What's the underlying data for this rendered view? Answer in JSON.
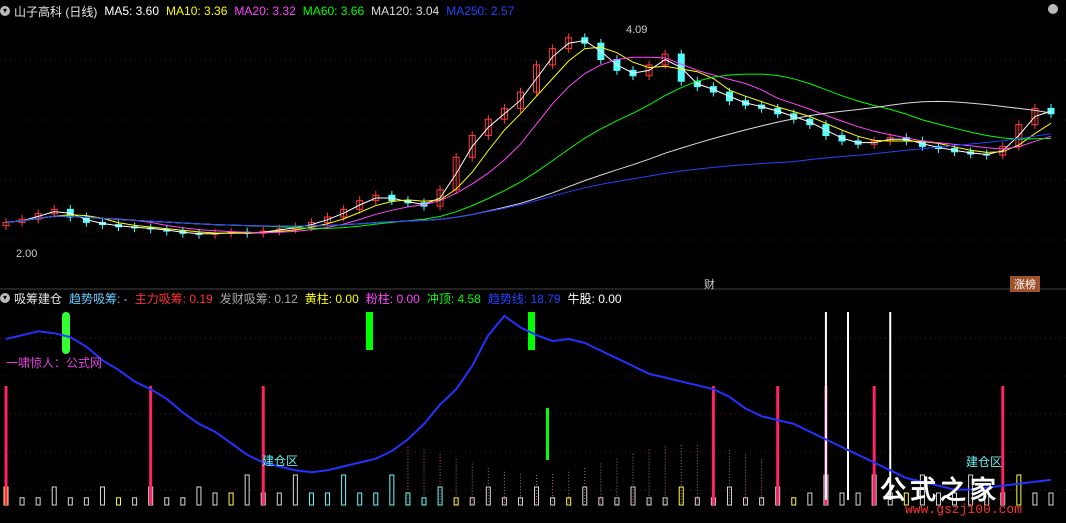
{
  "legend_main": {
    "title": "山子高科 (日线)",
    "items": [
      {
        "label": "MA5: 3.60",
        "color": "#ffffff"
      },
      {
        "label": "MA10: 3.36",
        "color": "#ffff00"
      },
      {
        "label": "MA20: 3.32",
        "color": "#ff44ff"
      },
      {
        "label": "MA60: 3.66",
        "color": "#00ff00"
      },
      {
        "label": "MA120: 3.04",
        "color": "#dddddd"
      },
      {
        "label": "MA250: 2.57",
        "color": "#2244ff"
      }
    ]
  },
  "legend_sub": {
    "title": "吸筹建仓",
    "items": [
      {
        "label": "趋势吸筹: -",
        "color": "#66ccff"
      },
      {
        "label": "主力吸筹: 0.19",
        "color": "#ff3333"
      },
      {
        "label": "发财吸筹: 0.12",
        "color": "#aaaaaa"
      },
      {
        "label": "黄柱: 0.00",
        "color": "#ffff00"
      },
      {
        "label": "粉柱: 0.00",
        "color": "#ff44ff"
      },
      {
        "label": "冲顶: 4.58",
        "color": "#00ff00"
      },
      {
        "label": "趋势线: 18.79",
        "color": "#2244ff"
      },
      {
        "label": "牛股: 0.00",
        "color": "#ffffff"
      }
    ]
  },
  "labels": {
    "cai": "财",
    "zhang": "涨榜",
    "high_mark": "4.09",
    "low_mark": "2.00",
    "yixiao": "一啸惊人：公式网",
    "jiancang": "建仓区",
    "jiancang2": "建仓区"
  },
  "watermark": {
    "site": "公式之家",
    "url": "www.gszj100.com"
  },
  "chart_data": [
    {
      "type": "candlestick",
      "title": "山子高科 (日线)",
      "ylim": [
        2.0,
        4.09
      ],
      "note_high": 4.09,
      "note_low": 2.0,
      "price_path": [
        2.3,
        2.33,
        2.38,
        2.42,
        2.35,
        2.3,
        2.28,
        2.26,
        2.25,
        2.24,
        2.22,
        2.2,
        2.19,
        2.2,
        2.21,
        2.2,
        2.22,
        2.24,
        2.26,
        2.3,
        2.35,
        2.42,
        2.5,
        2.55,
        2.5,
        2.48,
        2.45,
        2.6,
        2.9,
        3.1,
        3.25,
        3.35,
        3.5,
        3.75,
        3.9,
        4.0,
        3.95,
        3.8,
        3.7,
        3.65,
        3.75,
        3.85,
        3.6,
        3.55,
        3.5,
        3.42,
        3.38,
        3.35,
        3.3,
        3.25,
        3.2,
        3.1,
        3.05,
        3.02,
        3.05,
        3.08,
        3.05,
        3.0,
        2.98,
        2.95,
        2.93,
        2.92,
        3.0,
        3.2,
        3.35,
        3.3
      ],
      "ma": [
        {
          "name": "MA5",
          "color": "#ffffff",
          "last": 3.6
        },
        {
          "name": "MA10",
          "color": "#ffff00",
          "last": 3.36
        },
        {
          "name": "MA20",
          "color": "#ff44ff",
          "last": 3.32
        },
        {
          "name": "MA60",
          "color": "#00ff00",
          "last": 3.66
        },
        {
          "name": "MA120",
          "color": "#dddddd",
          "last": 3.04
        },
        {
          "name": "MA250",
          "color": "#2244ff",
          "last": 2.57
        }
      ]
    },
    {
      "type": "line",
      "title": "吸筹建仓",
      "series": [
        {
          "name": "趋势线",
          "color": "#2244ff",
          "values": [
            86,
            88,
            90,
            89,
            87,
            82,
            75,
            70,
            64,
            60,
            55,
            48,
            42,
            38,
            32,
            26,
            22,
            20,
            18,
            17,
            18,
            20,
            22,
            24,
            28,
            34,
            42,
            52,
            60,
            72,
            88,
            98,
            92,
            88,
            85,
            86,
            84,
            80,
            76,
            72,
            68,
            66,
            64,
            62,
            60,
            56,
            50,
            46,
            44,
            42,
            38,
            34,
            30,
            26,
            22,
            18,
            14,
            12,
            10,
            8,
            8,
            9,
            10,
            11,
            12,
            13
          ]
        }
      ]
    }
  ]
}
